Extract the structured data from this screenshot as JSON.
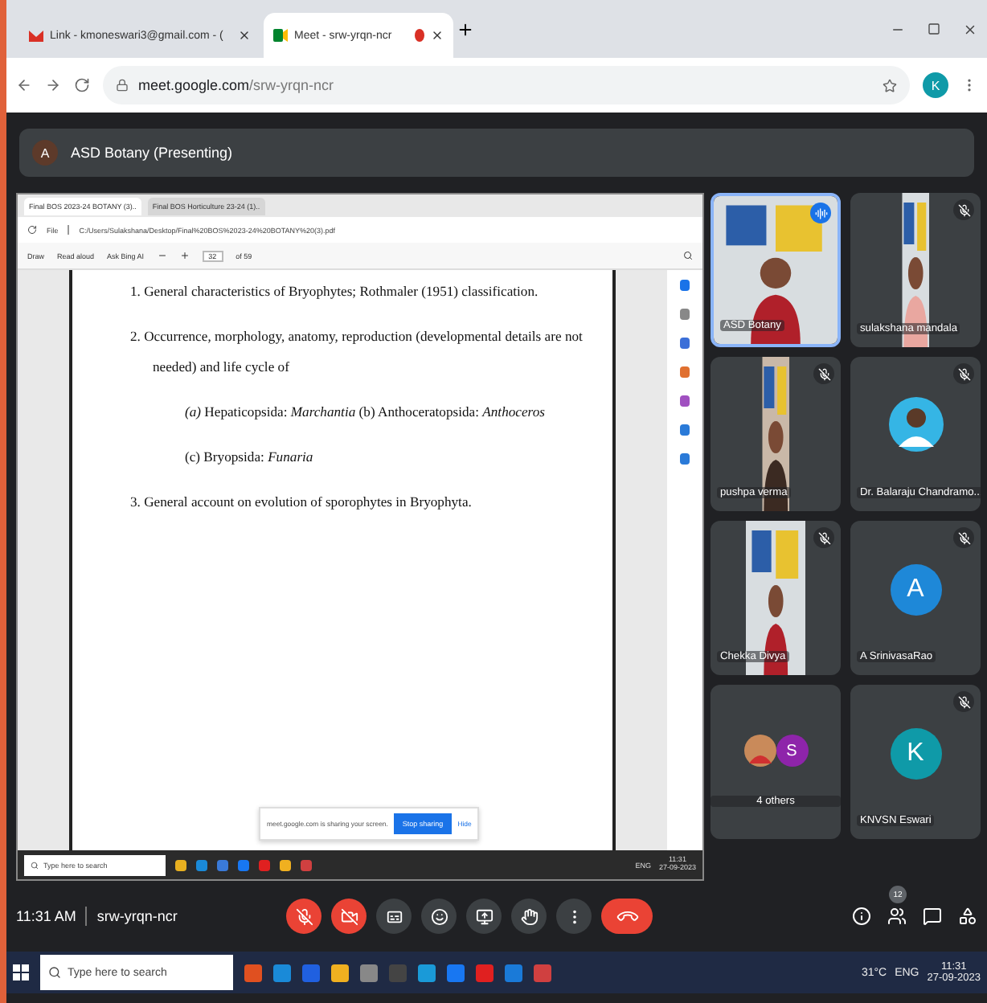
{
  "browser": {
    "tabs": [
      {
        "kind": "mail",
        "title": "Link - kmoneswari3@gmail.com - (",
        "selected": false,
        "recording": false
      },
      {
        "kind": "meet",
        "title": "Meet - srw-yrqn-ncr",
        "selected": true,
        "recording": true
      }
    ],
    "url_host": "meet.google.com",
    "url_path": "/srw-yrqn-ncr",
    "profile": "K"
  },
  "presenter": {
    "initial": "A",
    "label": "ASD Botany (Presenting)"
  },
  "shared_screen": {
    "tabs": [
      {
        "title": "Final BOS 2023-24 BOTANY (3)..",
        "selected": true
      },
      {
        "title": "Final BOS Horticulture 23-24 (1)..",
        "selected": false
      }
    ],
    "file_label": "File",
    "path": "C:/Users/Sulakshana/Desktop/Final%20BOS%2023-24%20BOTANY%20(3).pdf",
    "toolbar": {
      "draw": "Draw",
      "read_aloud": "Read aloud",
      "ask": "Ask Bing AI",
      "page": "32",
      "page_total": "of 59"
    },
    "lines": [
      {
        "kind": "item",
        "text": "1.  General characteristics of Bryophytes; Rothmaler (1951) classification."
      },
      {
        "kind": "item",
        "text": "2.  Occurrence, morphology, anatomy, reproduction (developmental details are not needed) and life cycle of"
      },
      {
        "kind": "sub",
        "text": "*(a)* Hepaticopsida: *Marchantia* (b) Anthoceratopsida: *Anthoceros*"
      },
      {
        "kind": "sub",
        "text": "(c) Bryopsida: *Funaria*"
      },
      {
        "kind": "plain",
        "text": "3. General account on evolution of sporophytes in Bryophyta."
      }
    ],
    "share_bar": {
      "message": "meet.google.com is sharing your screen.",
      "stop": "Stop sharing",
      "hide": "Hide"
    },
    "taskbar": {
      "search": "Type here to search",
      "lang": "ENG",
      "time": "11:31",
      "date": "27-09-2023"
    }
  },
  "participants": [
    {
      "name": "ASD Botany",
      "kind": "video",
      "muted": false,
      "speaking": true
    },
    {
      "name": "sulakshana mandala",
      "kind": "video",
      "muted": true,
      "speaking": false
    },
    {
      "name": "pushpa verma",
      "kind": "video",
      "muted": true,
      "speaking": false
    },
    {
      "name": "Dr. Balaraju Chandramo...",
      "muted": true,
      "speaking": false
    },
    {
      "name": "Chekka Divya",
      "kind": "video",
      "muted": true,
      "speaking": false
    },
    {
      "name": "A SrinivasaRao",
      "kind": "letter",
      "letter": "A",
      "color": "#1e88d8",
      "muted": true,
      "speaking": false
    },
    {
      "name": "4 others",
      "kind": "group",
      "letter": "S",
      "color": "#8e24aa",
      "muted": false,
      "speaking": false
    },
    {
      "name": "KNVSN Eswari",
      "kind": "letter",
      "letter": "K",
      "color": "#0f9aa8",
      "muted": true,
      "speaking": false
    }
  ],
  "meeting": {
    "time": "11:31 AM",
    "code": "srw-yrqn-ncr",
    "people_count": "12",
    "controls": [
      {
        "kind": "mic",
        "on": false
      },
      {
        "kind": "camera",
        "on": false
      },
      {
        "kind": "captions"
      },
      {
        "kind": "emoji"
      },
      {
        "kind": "present"
      },
      {
        "kind": "hand"
      },
      {
        "kind": "more"
      },
      {
        "kind": "hangup"
      }
    ]
  },
  "taskbar": {
    "search": "Type here to search",
    "weather": "31°C",
    "lang": "ENG",
    "time": "11:31",
    "date": "27-09-2023"
  }
}
